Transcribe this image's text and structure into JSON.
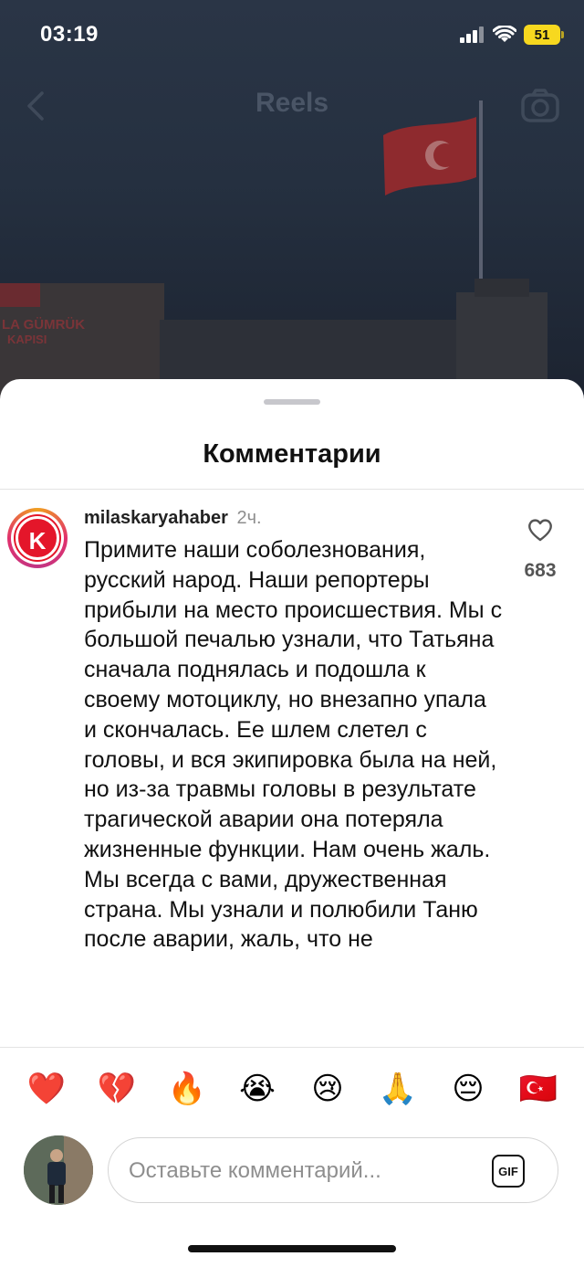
{
  "status_bar": {
    "time": "03:19",
    "battery": "51"
  },
  "header": {
    "title": "Reels",
    "back_icon": "chevron-left-icon",
    "camera_icon": "camera-icon"
  },
  "sheet": {
    "title": "Комментарии"
  },
  "comment": {
    "avatar_letter": "K",
    "username": "milaskaryahaber",
    "time": "2ч.",
    "text": "Примите наши соболезнования, русский народ. Наши репортеры прибыли на место происшествия. Мы с большой печалью узнали, что Татьяна сначала поднялась и подошла к своему мотоциклу, но внезапно упала и скончалась. Ее шлем слетел с головы, и вся экипировка была на ней, но из-за травмы головы в результате трагической аварии она потеряла жизненные функции. Нам очень жаль. Мы всегда с вами, дружественная страна. Мы узнали и полюбили Таню после аварии, жаль, что не",
    "likes": "683"
  },
  "reactions": [
    "❤️",
    "💔",
    "🔥",
    "😭",
    "😢",
    "🙏",
    "😔",
    "🇹🇷"
  ],
  "input": {
    "placeholder": "Оставьте комментарий...",
    "value": "",
    "gif_label": "GIF"
  }
}
